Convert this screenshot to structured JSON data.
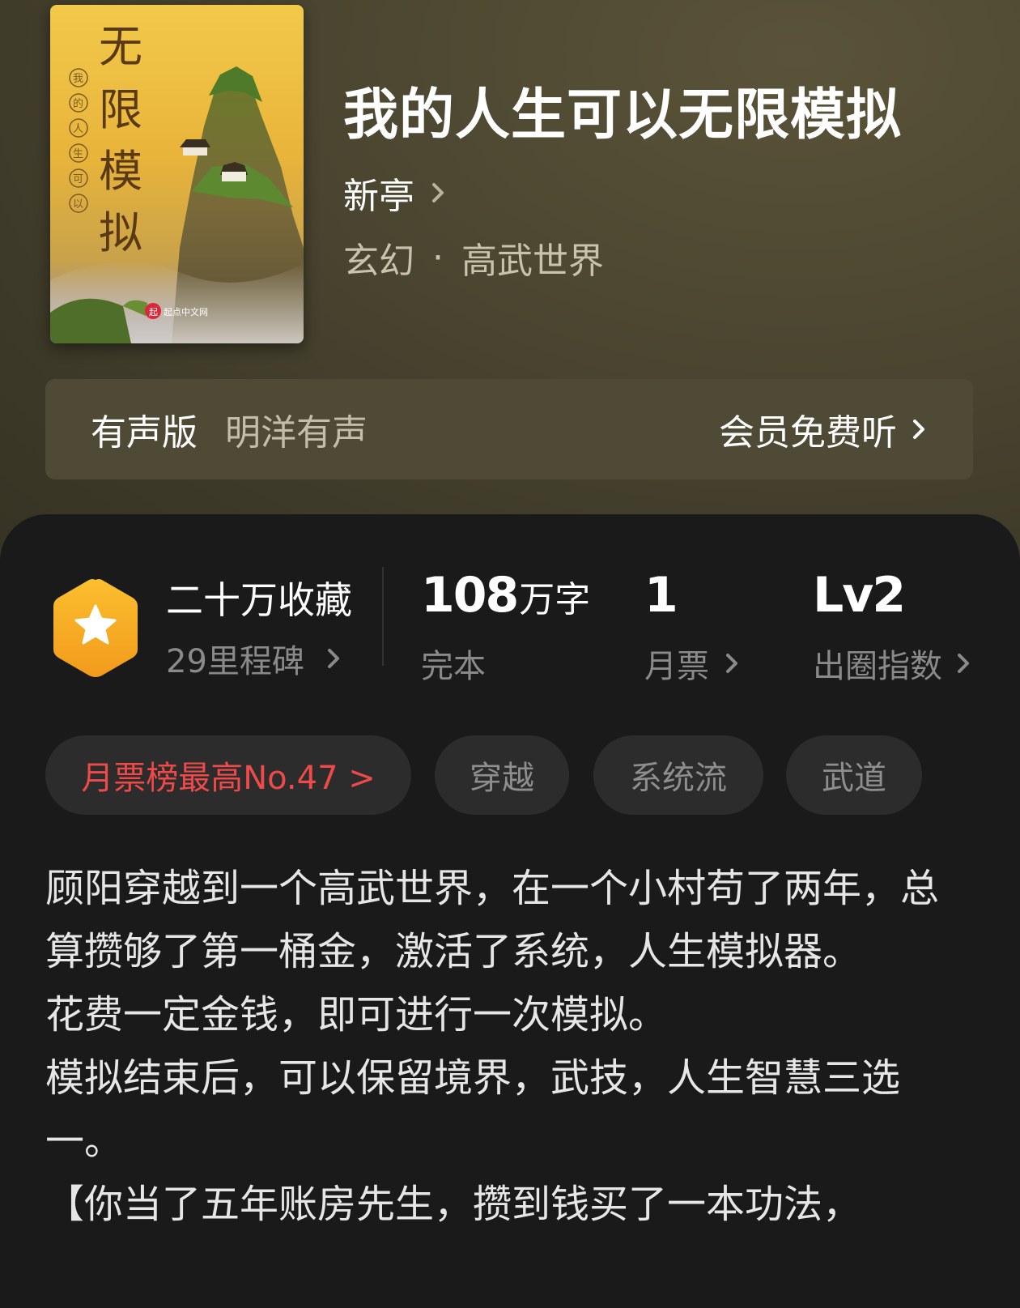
{
  "book": {
    "title": "我的人生可以无限模拟",
    "author": "新亭",
    "genre": "玄幻",
    "subgenre": "高武世界",
    "genre_separator": "·",
    "cover_title_chars": [
      "无",
      "限",
      "模",
      "拟"
    ],
    "cover_subtitle_chars": [
      "我",
      "的",
      "人",
      "生",
      "可",
      "以"
    ],
    "cover_publisher": "起点中文网"
  },
  "audio": {
    "label": "有声版",
    "narrator": "明洋有声",
    "cta": "会员免费听"
  },
  "stats": {
    "collections": "二十万收藏",
    "milestones": "29里程碑",
    "word_count_num": "108",
    "word_count_unit": "万字",
    "status": "完本",
    "monthly_tickets": "1",
    "monthly_tickets_label": "月票",
    "level": "Lv2",
    "level_label": "出圈指数"
  },
  "tags": {
    "rank": "月票榜最高No.47 >",
    "items": [
      "穿越",
      "系统流",
      "武道"
    ]
  },
  "description": [
    "顾阳穿越到一个高武世界，在一个小村苟了两年，总算攒够了第一桶金，激活了系统，人生模拟器。",
    "花费一定金钱，即可进行一次模拟。",
    "模拟结束后，可以保留境界，武技，人生智慧三选一。",
    "【你当了五年账房先生，攒到钱买了一本功法，"
  ],
  "colors": {
    "badge": "#f6a623",
    "rank_tag": "#ee4a4a",
    "hero_bg": "#4a4530",
    "panel_bg": "#1a1a1a"
  },
  "icons": {
    "chevron": "chevron-right-icon",
    "badge": "star-hexagon-icon"
  }
}
